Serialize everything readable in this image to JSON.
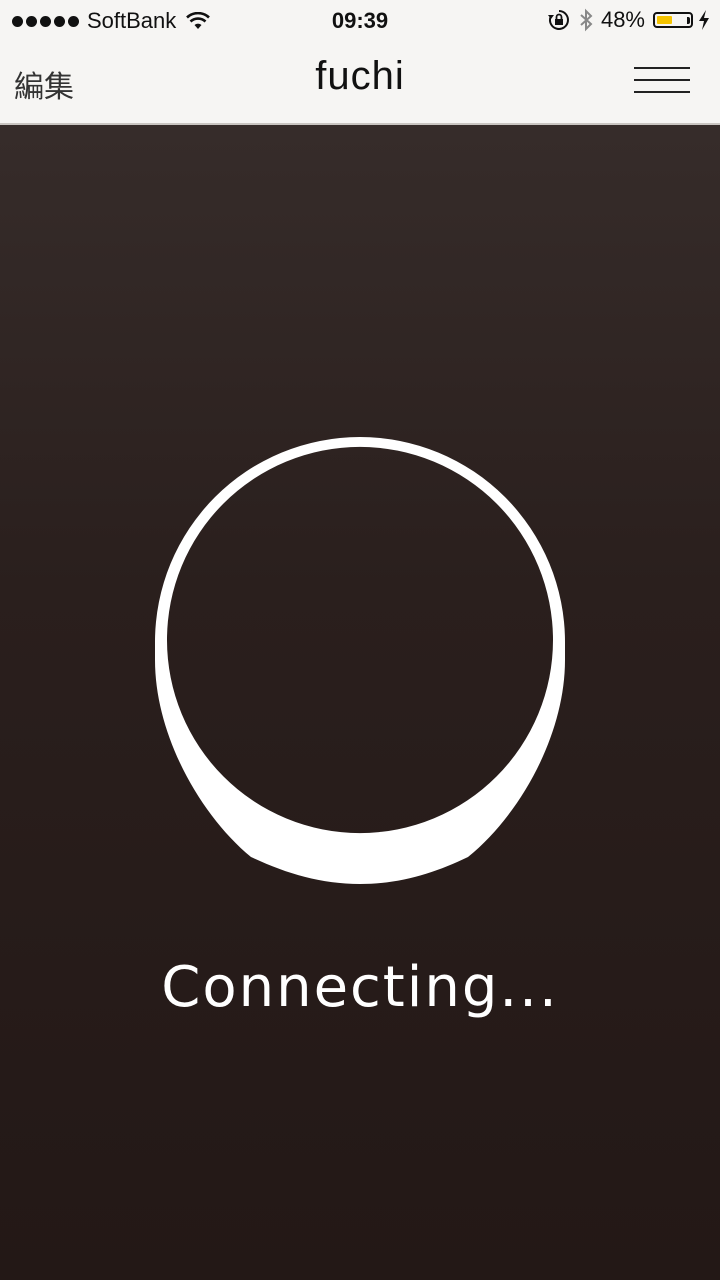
{
  "statusbar": {
    "carrier": "SoftBank",
    "time": "09:39",
    "battery": "48%",
    "battery_level": 0.48,
    "icons": [
      "signal-dots-icon",
      "wifi-icon",
      "orientation-lock-icon",
      "bluetooth-icon",
      "battery-icon",
      "charging-bolt-icon"
    ]
  },
  "navbar": {
    "edit_label": "編集",
    "title": "fuchi",
    "menu_icon": "hamburger-menu-icon"
  },
  "main": {
    "status_text": "Connecting...",
    "logo_icon": "device-ring-icon",
    "accent_color": "#231816"
  }
}
